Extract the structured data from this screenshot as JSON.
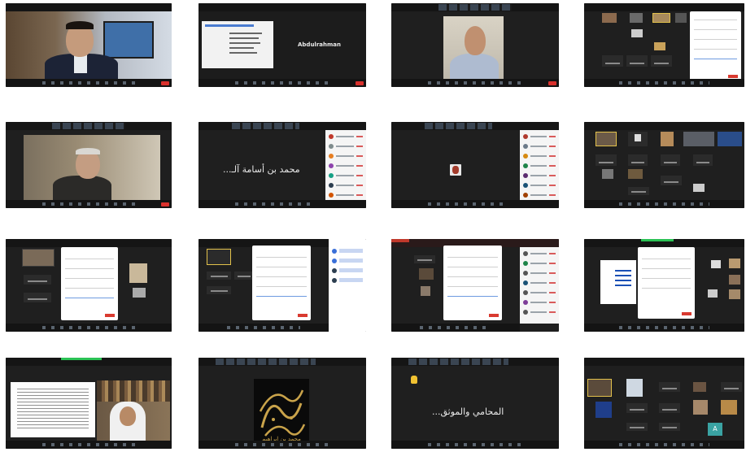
{
  "collage": {
    "shot2": {
      "speaker_name": "Abdulrahman"
    },
    "shot6": {
      "speaker_name": "محمد بن أسامة آلـ..."
    },
    "shot15": {
      "calligraphy_text": "محمد بن ابراهيم"
    },
    "shot16": {
      "caption_text": "المحامي والموثق..."
    }
  },
  "colors": {
    "zoom_bg": "#1f1f1f",
    "end_button": "#d9312d",
    "active_green": "#2bc255",
    "highlight_yellow": "#f1c232"
  },
  "icons": [
    "hand-icon",
    "tile-thumbnail",
    "end-meeting-button"
  ]
}
